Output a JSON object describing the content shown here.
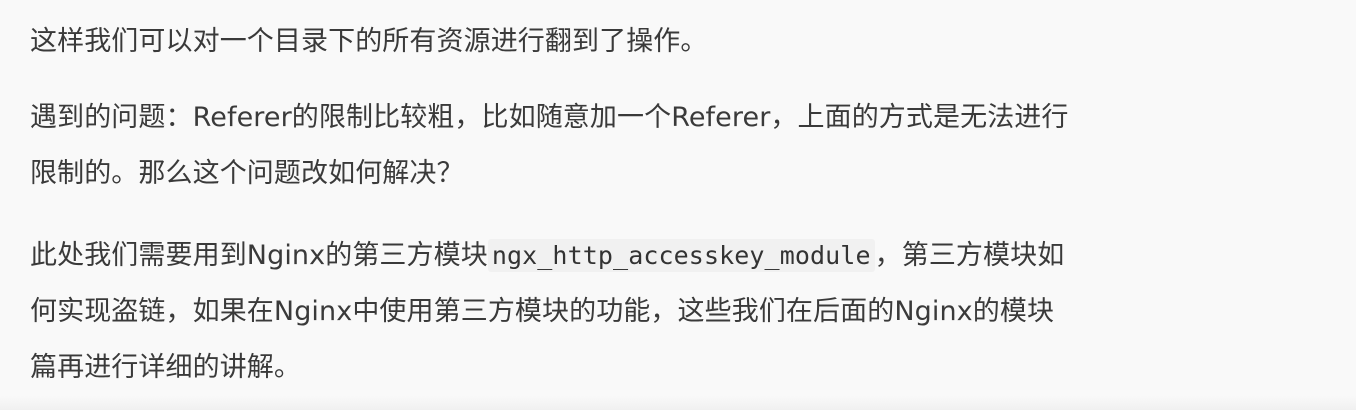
{
  "document": {
    "para1": "这样我们可以对一个目录下的所有资源进行翻到了操作。",
    "para2": {
      "line1": "遇到的问题：Referer的限制比较粗，比如随意加一个Referer，上面的方式是无法进行",
      "line2": "限制的。那么这个问题改如何解决？"
    },
    "para3": {
      "line1_prefix": "此处我们需要用到Nginx的第三方模块",
      "line1_code": "ngx_http_accesskey_module",
      "line1_suffix": "，第三方模块如",
      "line2": "何实现盗链，如果在Nginx中使用第三方模块的功能，这些我们在后面的Nginx的模块",
      "line3": "篇再进行详细的讲解。"
    }
  }
}
